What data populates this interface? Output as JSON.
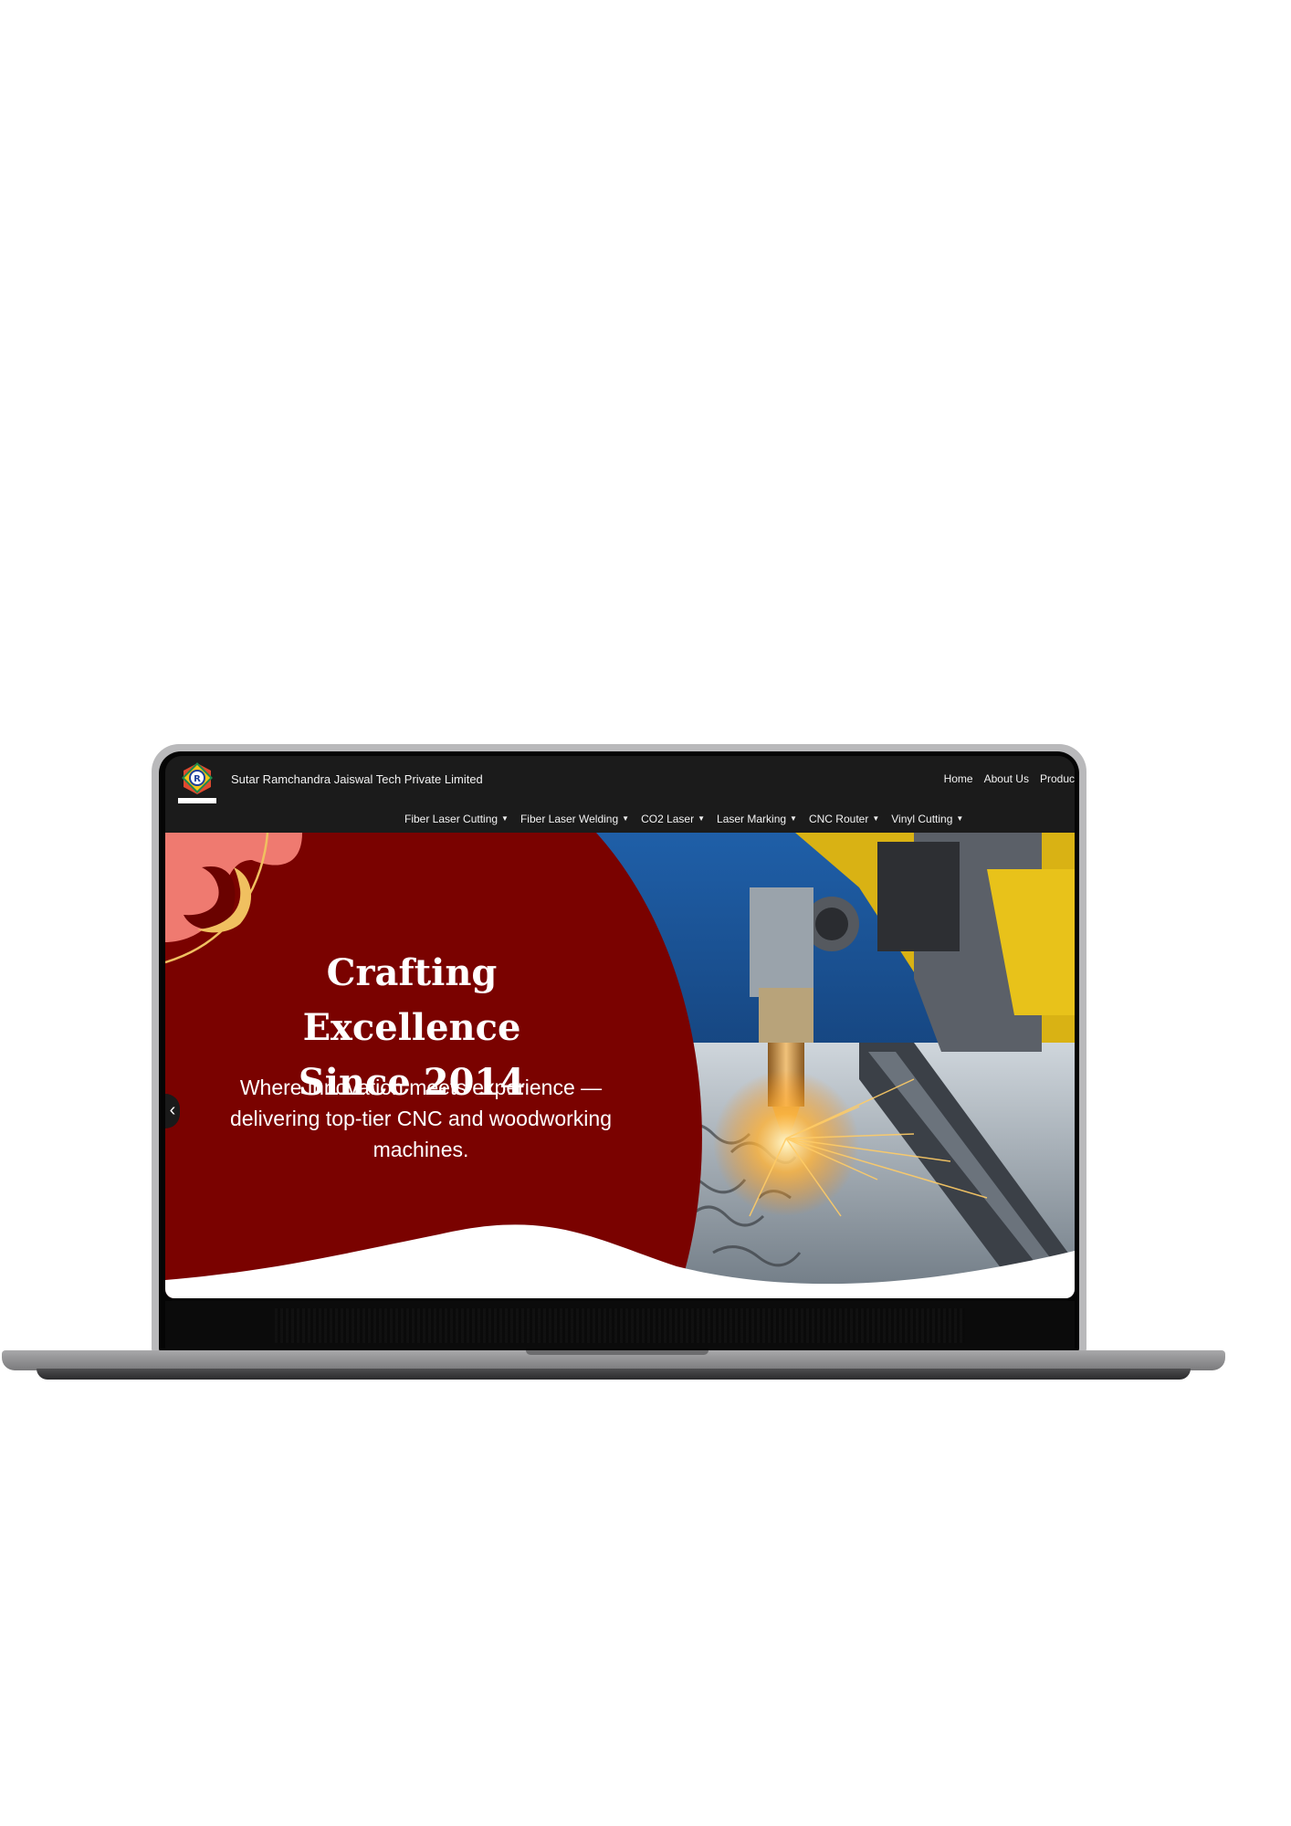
{
  "brand": {
    "logo_icon": "srj-logo-icon",
    "name": "Sutar Ramchandra Jaiswal Tech Private Limited"
  },
  "nav_top": {
    "items": [
      "Home",
      "About Us",
      "Produc"
    ]
  },
  "nav_bottom": {
    "items": [
      {
        "label": "Fiber Laser Cutting",
        "icon": "caret-down-icon"
      },
      {
        "label": "Fiber Laser Welding",
        "icon": "caret-down-icon"
      },
      {
        "label": "CO2 Laser",
        "icon": "caret-down-icon"
      },
      {
        "label": "Laser Marking",
        "icon": "caret-down-icon"
      },
      {
        "label": "CNC Router",
        "icon": "caret-down-icon"
      },
      {
        "label": "Vinyl Cutting",
        "icon": "caret-down-icon"
      }
    ]
  },
  "hero": {
    "title_line1": "Crafting Excellence",
    "title_line2": "Since 2014",
    "subtitle_line1": "Where innovation meets experience —",
    "subtitle_line2": "delivering top-tier CNC and woodworking",
    "subtitle_line3": "machines.",
    "prev_icon": "chevron-left-icon",
    "colors": {
      "panel": "#7a0200",
      "accent_salmon": "#ef7a70",
      "accent_gold": "#f0c060"
    }
  }
}
